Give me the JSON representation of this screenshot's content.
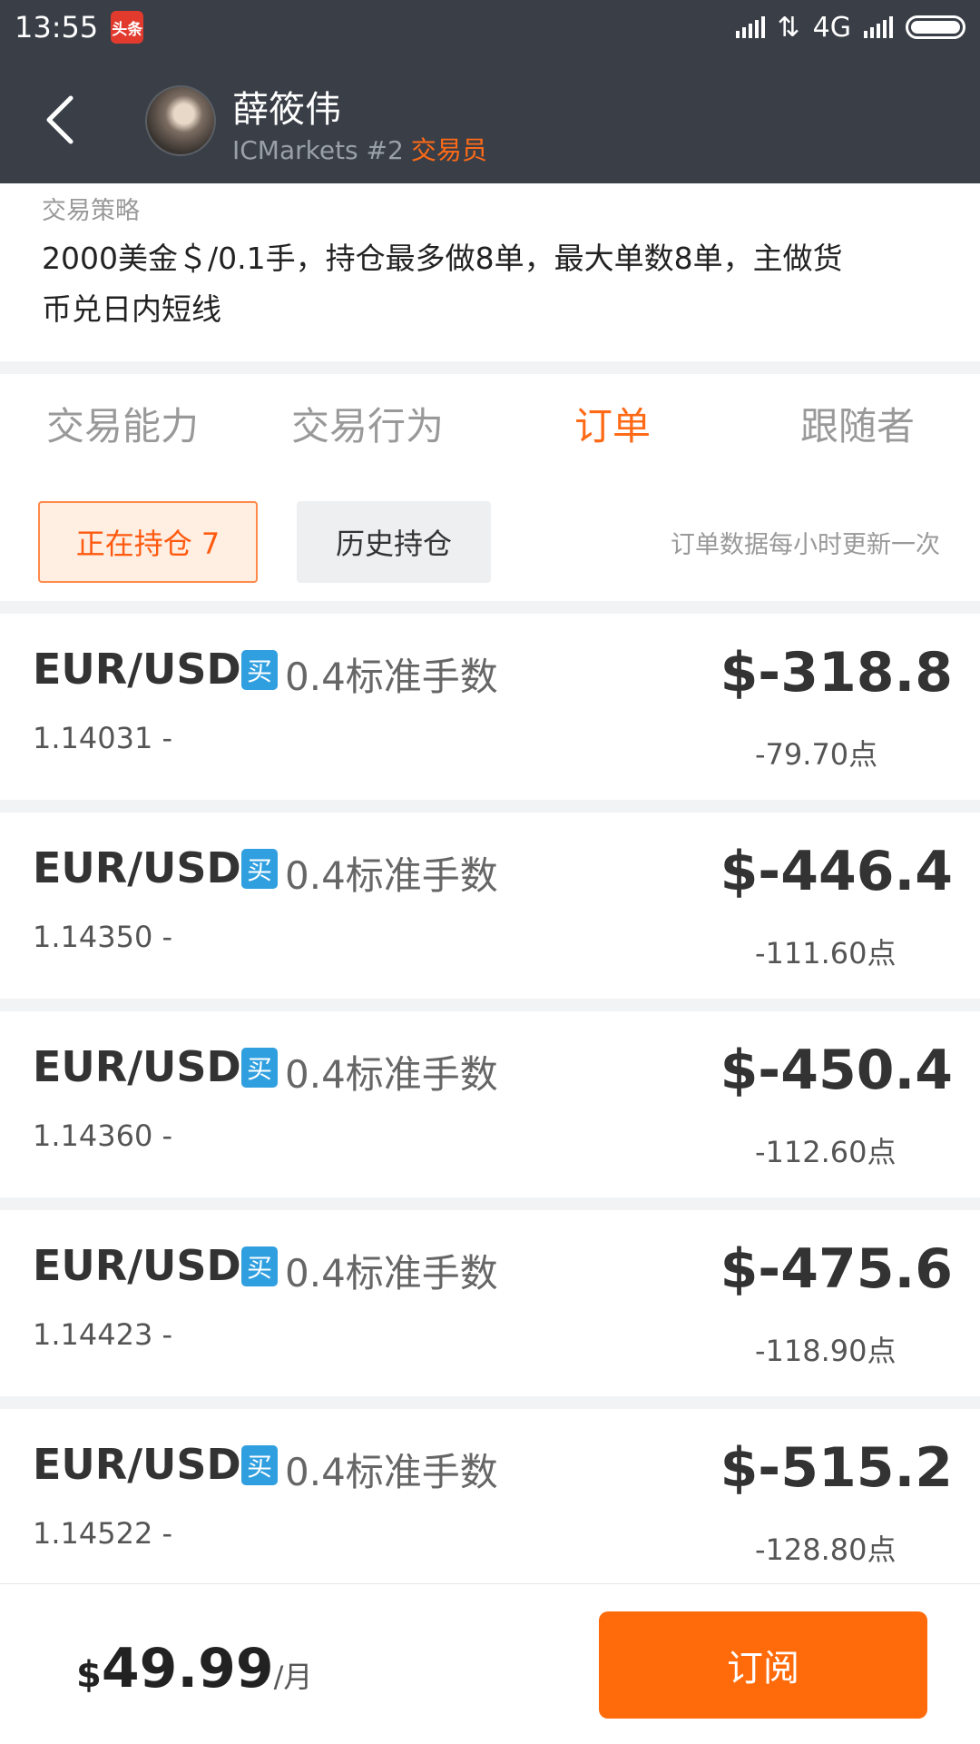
{
  "status_bar": {
    "time": "13:55",
    "app_badge": "头条",
    "network": "4G"
  },
  "header": {
    "trader_name": "薛筱伟",
    "broker": "ICMarkets #2",
    "role": "交易员"
  },
  "strategy": {
    "label": "交易策略",
    "text": "2000美金＄/0.1手，持仓最多做8单，最大单数8单，主做货币兑日内短线"
  },
  "tabs": [
    {
      "label": "交易能力"
    },
    {
      "label": "交易行为"
    },
    {
      "label": "订单",
      "active": true
    },
    {
      "label": "跟随者"
    }
  ],
  "filter": {
    "open_positions": "正在持仓 7",
    "history_positions": "历史持仓",
    "update_note": "订单数据每小时更新一次"
  },
  "orders": [
    {
      "pair": "EUR/USD",
      "side": "买",
      "lots": "0.4标准手数",
      "open_price": "1.14031 -",
      "profit": "$-318.8",
      "points": "-79.70点"
    },
    {
      "pair": "EUR/USD",
      "side": "买",
      "lots": "0.4标准手数",
      "open_price": "1.14350 -",
      "profit": "$-446.4",
      "points": "-111.60点"
    },
    {
      "pair": "EUR/USD",
      "side": "买",
      "lots": "0.4标准手数",
      "open_price": "1.14360 -",
      "profit": "$-450.4",
      "points": "-112.60点"
    },
    {
      "pair": "EUR/USD",
      "side": "买",
      "lots": "0.4标准手数",
      "open_price": "1.14423 -",
      "profit": "$-475.6",
      "points": "-118.90点"
    },
    {
      "pair": "EUR/USD",
      "side": "买",
      "lots": "0.4标准手数",
      "open_price": "1.14522 -",
      "profit": "$-515.2",
      "points": "-128.80点"
    }
  ],
  "subscription": {
    "currency": "$",
    "price": "49.99",
    "period": "/月",
    "button_label": "订阅"
  },
  "colors": {
    "accent": "#ff6a0a",
    "header_bg": "#3a3f47",
    "buy_badge": "#2f9fe0"
  }
}
